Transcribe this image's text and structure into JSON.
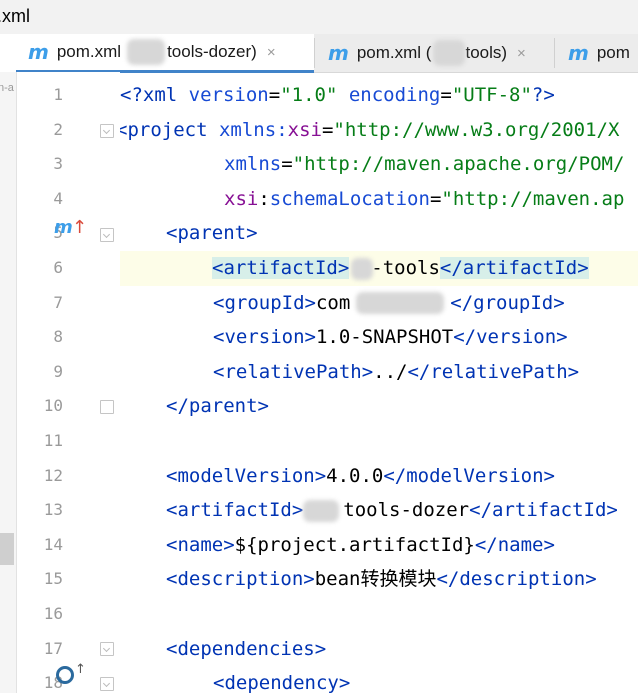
{
  "window": {
    "title": ".xml"
  },
  "tabs": [
    {
      "icon": "maven-icon",
      "label_prefix": "pom.xml",
      "label_suffix": "tools-dozer)",
      "active": true,
      "close": "×"
    },
    {
      "icon": "maven-icon",
      "label_prefix": "pom.xml (",
      "label_suffix": "tools)",
      "active": false,
      "close": "×"
    },
    {
      "icon": "maven-icon",
      "label_prefix": "pom",
      "label_suffix": "",
      "active": false
    }
  ],
  "side": {
    "crumb": "n-a"
  },
  "gutter": {
    "line_numbers": [
      "1",
      "2",
      "3",
      "4",
      "5",
      "6",
      "7",
      "8",
      "9",
      "10",
      "11",
      "12",
      "13",
      "14",
      "15",
      "16",
      "17",
      "18"
    ],
    "maven_marker": "m",
    "override_arrow": "↑",
    "implemented_arrow": "↑"
  },
  "code": {
    "l1": {
      "open": "<?",
      "name": "xml",
      "a1": "version",
      "v1": "\"1.0\"",
      "a2": "encoding",
      "v2": "\"UTF-8\"",
      "close": "?>"
    },
    "l2": {
      "open": "<",
      "tag": "project",
      "ns": "xmlns",
      "colon": ":",
      "attr": "xsi",
      "eq": "=",
      "val": "\"http://www.w3.org/2001/X"
    },
    "l3": {
      "attr": "xmlns",
      "eq": "=",
      "val": "\"http://maven.apache.org/POM/"
    },
    "l4": {
      "ns": "xsi",
      "colon": ":",
      "attr": "schemaLocation",
      "eq": "=",
      "val": "\"http://maven.ap"
    },
    "l5": {
      "text": "<parent>"
    },
    "l6": {
      "open": "<artifactId>",
      "text": "-tools",
      "close": "</artifactId>"
    },
    "l7": {
      "open": "<groupId>",
      "text": "com",
      "close": "</groupId>"
    },
    "l8": {
      "open": "<version>",
      "text": "1.0-SNAPSHOT",
      "close": "</version>"
    },
    "l9": {
      "open": "<relativePath>",
      "text": "../",
      "close": "</relativePath>"
    },
    "l10": {
      "text": "</parent>"
    },
    "l12": {
      "open": "<modelVersion>",
      "text": "4.0.0",
      "close": "</modelVersion>"
    },
    "l13": {
      "open": "<artifactId>",
      "text": "tools-dozer",
      "close": "</artifactId>"
    },
    "l14": {
      "open": "<name>",
      "text": "${project.artifactId}",
      "close": "</name>"
    },
    "l15": {
      "open": "<description>",
      "text": "bean转换模块",
      "close": "</description>"
    },
    "l17": {
      "text": "<dependencies>"
    },
    "l18": {
      "text": "<dependency>"
    }
  }
}
